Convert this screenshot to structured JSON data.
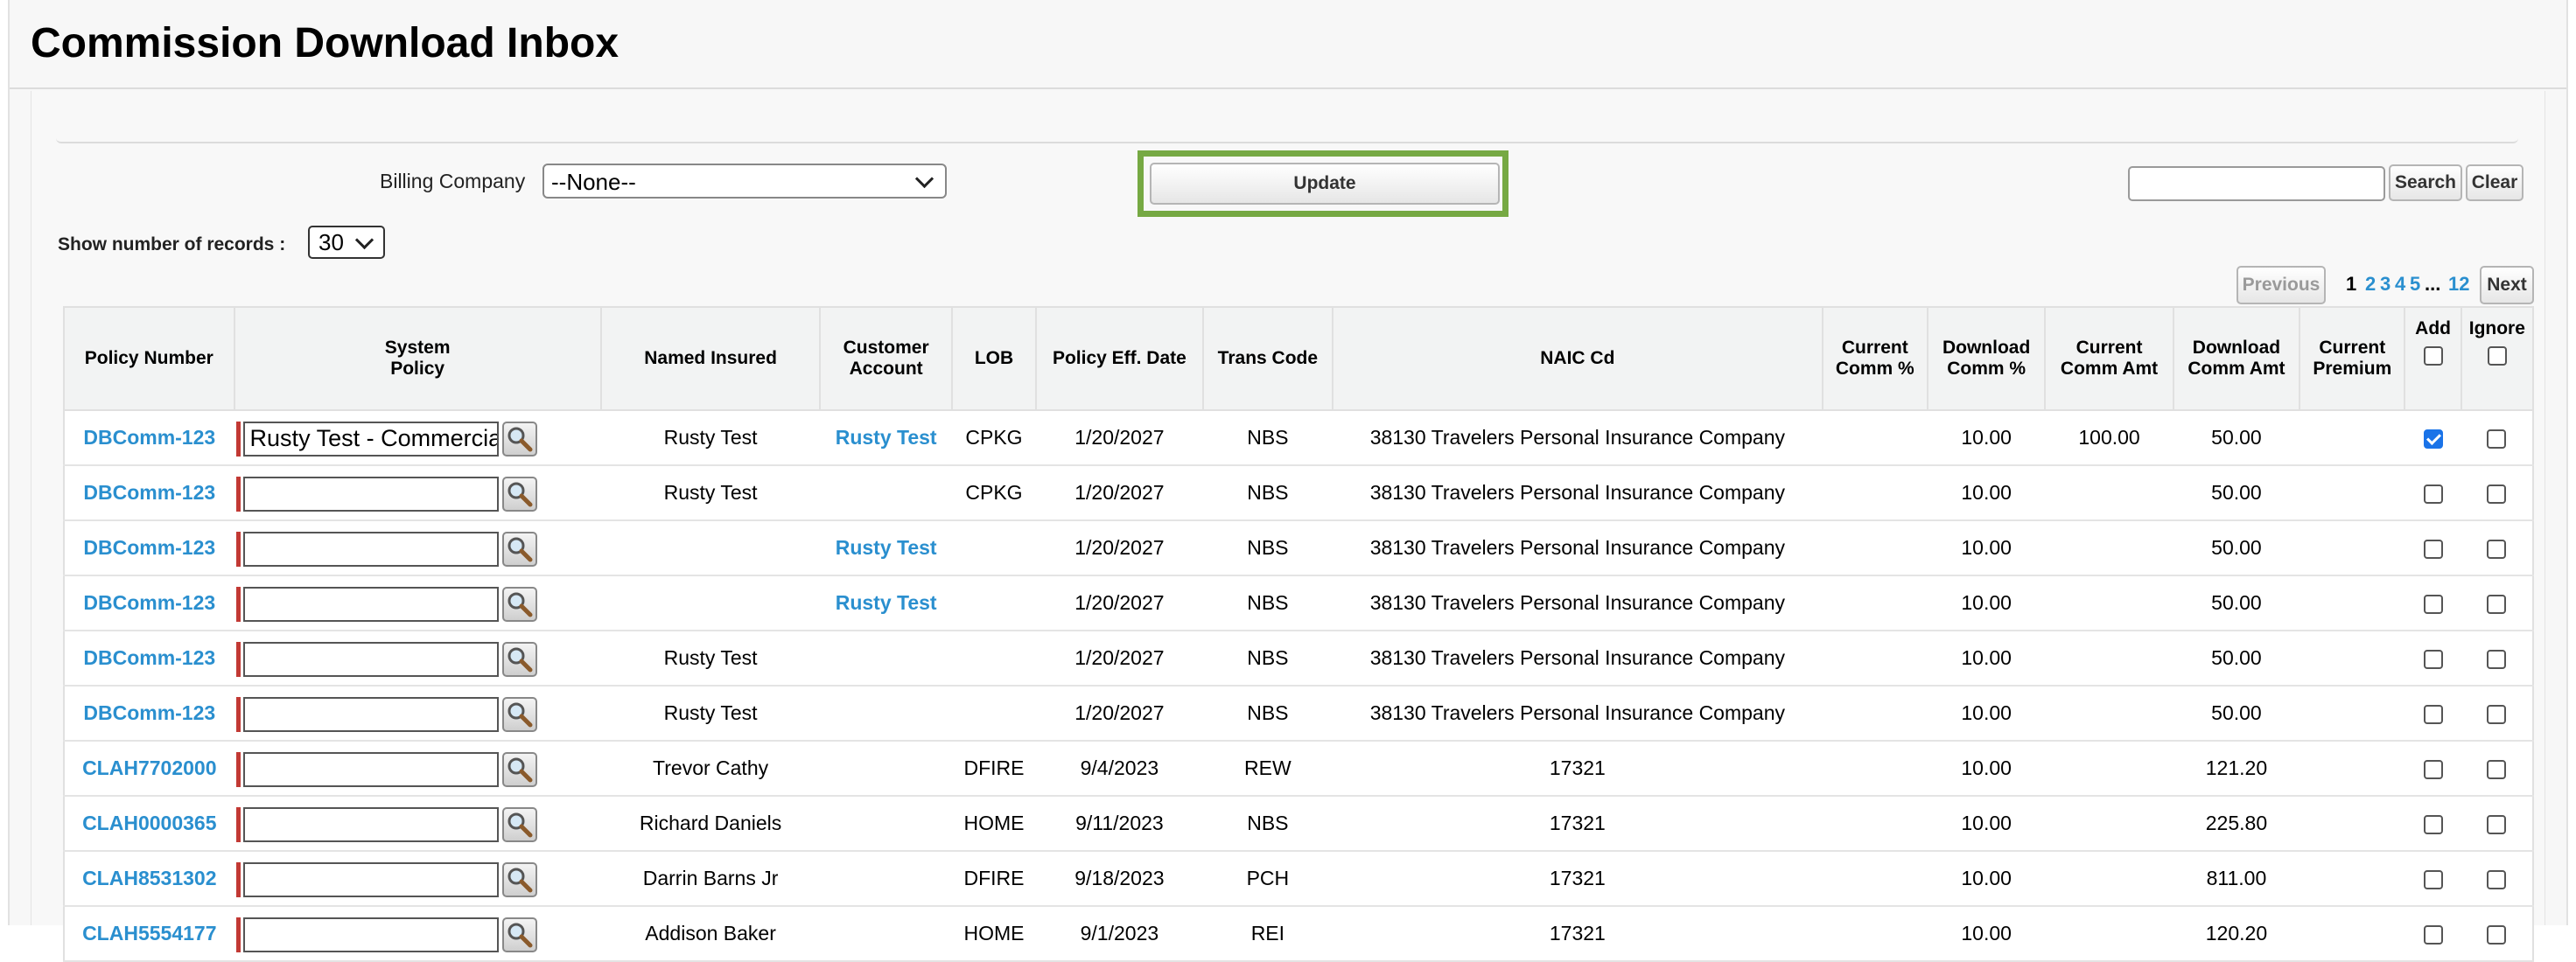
{
  "page": {
    "title": "Commission Download Inbox"
  },
  "filters": {
    "billing_company_label": "Billing Company",
    "billing_company_value": "--None--",
    "update_label": "Update",
    "search_value": "",
    "search_label": "Search",
    "clear_label": "Clear",
    "records_label": "Show number of records :",
    "records_value": "30"
  },
  "pagination": {
    "previous_label": "Previous",
    "current": "1",
    "pages": [
      "2",
      "3",
      "4",
      "5"
    ],
    "ellipsis": "...",
    "last": "12",
    "next_label": "Next"
  },
  "table": {
    "headers": {
      "policy_number": "Policy Number",
      "system_policy_1": "System",
      "system_policy_2": "Policy",
      "named_insured": "Named Insured",
      "customer_account_1": "Customer",
      "customer_account_2": "Account",
      "lob": "LOB",
      "policy_eff_date": "Policy Eff. Date",
      "trans_code": "Trans Code",
      "naic_cd": "NAIC Cd",
      "current_comm_pct_1": "Current",
      "current_comm_pct_2": "Comm %",
      "download_comm_pct_1": "Download",
      "download_comm_pct_2": "Comm %",
      "current_comm_amt_1": "Current",
      "current_comm_amt_2": "Comm Amt",
      "download_comm_amt_1": "Download",
      "download_comm_amt_2": "Comm Amt",
      "current_premium_1": "Current",
      "current_premium_2": "Premium",
      "add": "Add",
      "ignore": "Ignore"
    },
    "rows": [
      {
        "policy_number": "DBComm-123",
        "system_policy": "Rusty Test - Commercia",
        "named_insured": "Rusty Test",
        "customer_account": "Rusty Test",
        "lob": "CPKG",
        "eff_date": "1/20/2027",
        "trans_code": "NBS",
        "naic": "38130 Travelers Personal Insurance Company",
        "current_comm_pct": "",
        "download_comm_pct": "10.00",
        "current_comm_amt": "100.00",
        "download_comm_amt": "50.00",
        "current_premium": "",
        "add": true,
        "ignore": false
      },
      {
        "policy_number": "DBComm-123",
        "system_policy": "",
        "named_insured": "Rusty Test",
        "customer_account": "",
        "lob": "CPKG",
        "eff_date": "1/20/2027",
        "trans_code": "NBS",
        "naic": "38130 Travelers Personal Insurance Company",
        "current_comm_pct": "",
        "download_comm_pct": "10.00",
        "current_comm_amt": "",
        "download_comm_amt": "50.00",
        "current_premium": "",
        "add": false,
        "ignore": false
      },
      {
        "policy_number": "DBComm-123",
        "system_policy": "",
        "named_insured": "",
        "customer_account": "Rusty Test",
        "lob": "",
        "eff_date": "1/20/2027",
        "trans_code": "NBS",
        "naic": "38130 Travelers Personal Insurance Company",
        "current_comm_pct": "",
        "download_comm_pct": "10.00",
        "current_comm_amt": "",
        "download_comm_amt": "50.00",
        "current_premium": "",
        "add": false,
        "ignore": false
      },
      {
        "policy_number": "DBComm-123",
        "system_policy": "",
        "named_insured": "",
        "customer_account": "Rusty Test",
        "lob": "",
        "eff_date": "1/20/2027",
        "trans_code": "NBS",
        "naic": "38130 Travelers Personal Insurance Company",
        "current_comm_pct": "",
        "download_comm_pct": "10.00",
        "current_comm_amt": "",
        "download_comm_amt": "50.00",
        "current_premium": "",
        "add": false,
        "ignore": false
      },
      {
        "policy_number": "DBComm-123",
        "system_policy": "",
        "named_insured": "Rusty Test",
        "customer_account": "",
        "lob": "",
        "eff_date": "1/20/2027",
        "trans_code": "NBS",
        "naic": "38130 Travelers Personal Insurance Company",
        "current_comm_pct": "",
        "download_comm_pct": "10.00",
        "current_comm_amt": "",
        "download_comm_amt": "50.00",
        "current_premium": "",
        "add": false,
        "ignore": false
      },
      {
        "policy_number": "DBComm-123",
        "system_policy": "",
        "named_insured": "Rusty Test",
        "customer_account": "",
        "lob": "",
        "eff_date": "1/20/2027",
        "trans_code": "NBS",
        "naic": "38130 Travelers Personal Insurance Company",
        "current_comm_pct": "",
        "download_comm_pct": "10.00",
        "current_comm_amt": "",
        "download_comm_amt": "50.00",
        "current_premium": "",
        "add": false,
        "ignore": false
      },
      {
        "policy_number": "CLAH7702000",
        "system_policy": "",
        "named_insured": "Trevor Cathy",
        "customer_account": "",
        "lob": "DFIRE",
        "eff_date": "9/4/2023",
        "trans_code": "REW",
        "naic": "17321",
        "current_comm_pct": "",
        "download_comm_pct": "10.00",
        "current_comm_amt": "",
        "download_comm_amt": "121.20",
        "current_premium": "",
        "add": false,
        "ignore": false
      },
      {
        "policy_number": "CLAH0000365",
        "system_policy": "",
        "named_insured": "Richard Daniels",
        "customer_account": "",
        "lob": "HOME",
        "eff_date": "9/11/2023",
        "trans_code": "NBS",
        "naic": "17321",
        "current_comm_pct": "",
        "download_comm_pct": "10.00",
        "current_comm_amt": "",
        "download_comm_amt": "225.80",
        "current_premium": "",
        "add": false,
        "ignore": false
      },
      {
        "policy_number": "CLAH8531302",
        "system_policy": "",
        "named_insured": "Darrin Barns Jr",
        "customer_account": "",
        "lob": "DFIRE",
        "eff_date": "9/18/2023",
        "trans_code": "PCH",
        "naic": "17321",
        "current_comm_pct": "",
        "download_comm_pct": "10.00",
        "current_comm_amt": "",
        "download_comm_amt": "811.00",
        "current_premium": "",
        "add": false,
        "ignore": false
      },
      {
        "policy_number": "CLAH5554177",
        "system_policy": "",
        "named_insured": "Addison Baker",
        "customer_account": "",
        "lob": "HOME",
        "eff_date": "9/1/2023",
        "trans_code": "REI",
        "naic": "17321",
        "current_comm_pct": "",
        "download_comm_pct": "10.00",
        "current_comm_amt": "",
        "download_comm_amt": "120.20",
        "current_premium": "",
        "add": false,
        "ignore": false
      }
    ]
  },
  "icons": {
    "lookup": "magnifier-lookup-icon",
    "select_arrow": "chevron-down-icon"
  },
  "colors": {
    "link": "#2a8fcf",
    "highlight": "#76a943",
    "required_bar": "#c23934",
    "checkbox_checked": "#1a73e8"
  }
}
